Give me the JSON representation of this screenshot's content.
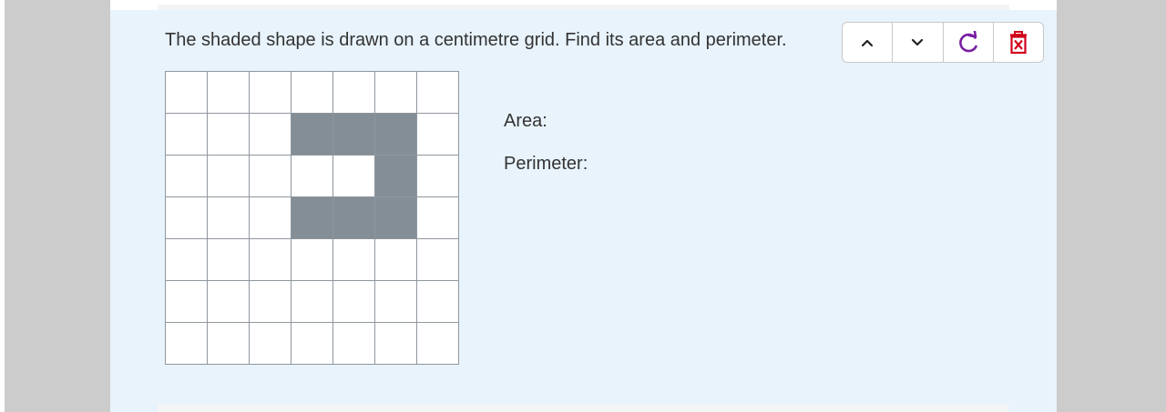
{
  "question": {
    "text": "The shaded shape is drawn on a centimetre grid. Find its area and perimeter."
  },
  "toolbar": {
    "buttons": [
      {
        "name": "move-up-button",
        "icon": "chevron-up-icon"
      },
      {
        "name": "move-down-button",
        "icon": "chevron-down-icon"
      },
      {
        "name": "refresh-button",
        "icon": "refresh-icon",
        "color": "#7a1fa2"
      },
      {
        "name": "delete-button",
        "icon": "delete-icon",
        "color": "#d0021b"
      }
    ]
  },
  "grid": {
    "rows": 7,
    "cols": 7,
    "shaded_cells": [
      [
        1,
        3
      ],
      [
        1,
        4
      ],
      [
        1,
        5
      ],
      [
        2,
        5
      ],
      [
        3,
        3
      ],
      [
        3,
        4
      ],
      [
        3,
        5
      ]
    ],
    "shade_color": "#848e96"
  },
  "answers": {
    "area_label": "Area:",
    "perimeter_label": "Perimeter:"
  }
}
